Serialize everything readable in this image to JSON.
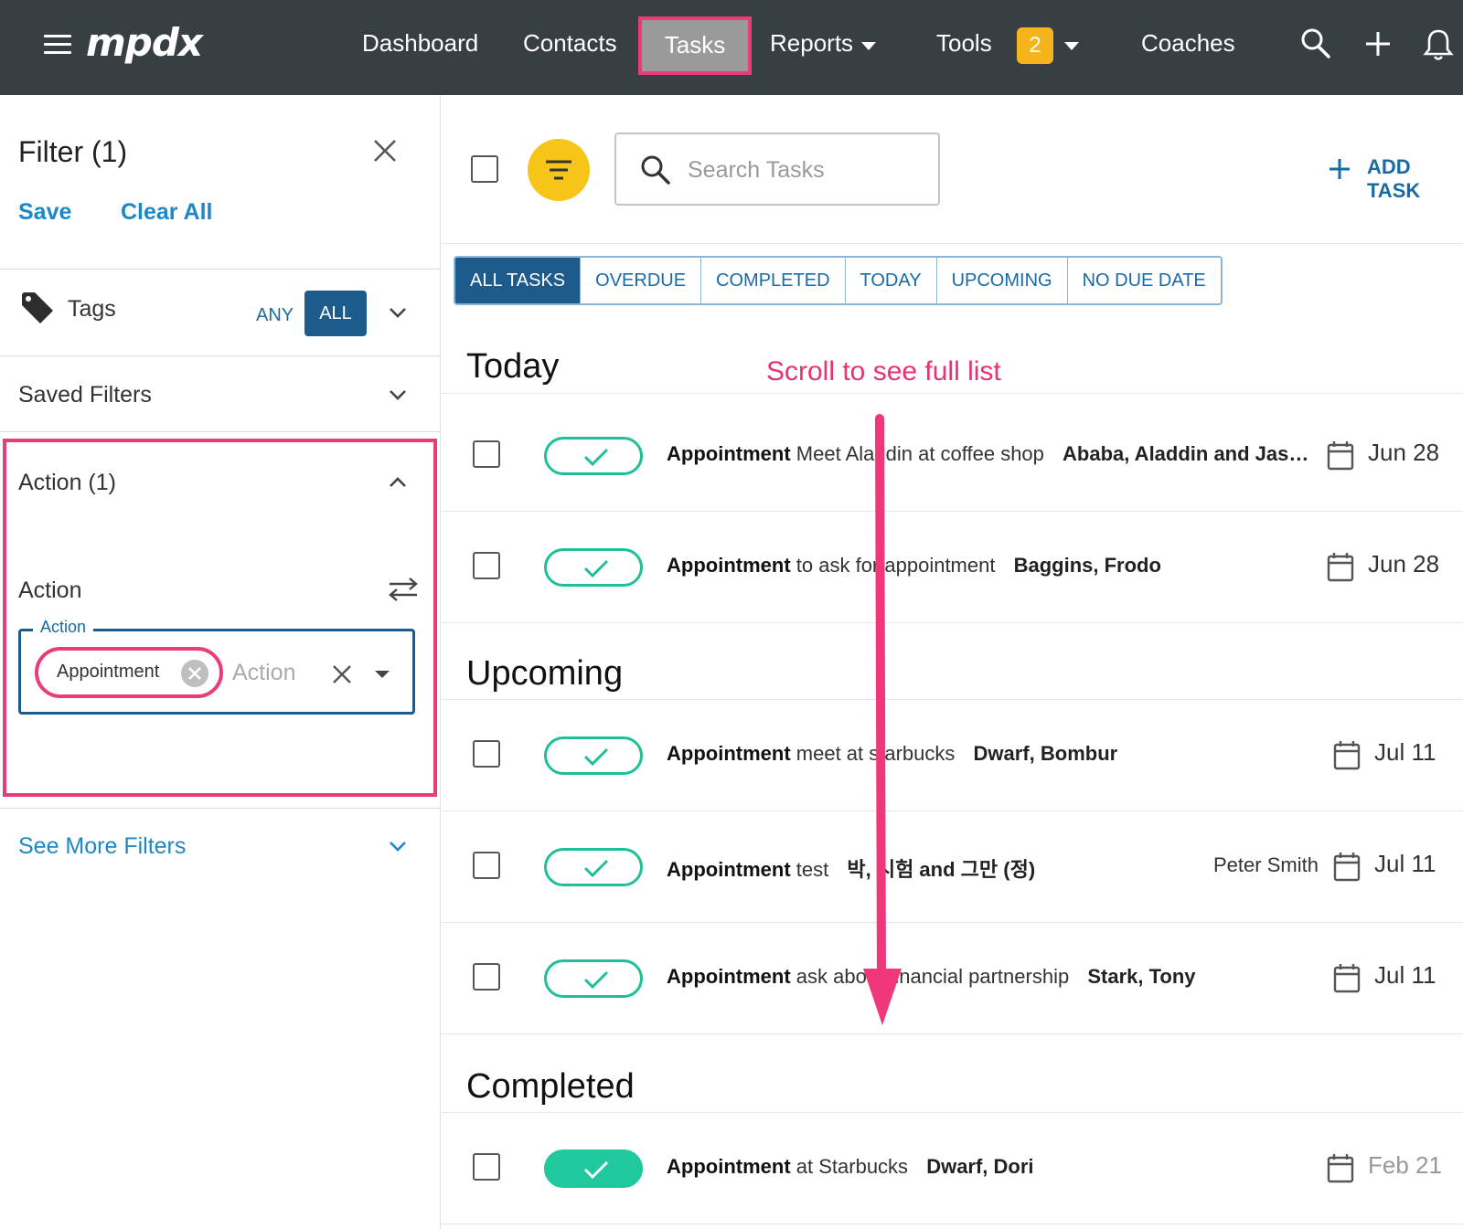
{
  "nav": {
    "logo": "mpdx",
    "items": {
      "dashboard": "Dashboard",
      "contacts": "Contacts",
      "tasks": "Tasks",
      "reports": "Reports",
      "tools": "Tools",
      "coaches": "Coaches"
    },
    "tools_badge": "2"
  },
  "sidebar": {
    "title": "Filter (1)",
    "save": "Save",
    "clear_all": "Clear All",
    "tags": {
      "label": "Tags",
      "any": "ANY",
      "all": "ALL"
    },
    "saved_filters": "Saved Filters",
    "action_section": {
      "title": "Action (1)",
      "field_label": "Action",
      "legend": "Action",
      "chip": "Appointment",
      "placeholder": "Action"
    },
    "see_more": "See More Filters"
  },
  "toolbar": {
    "search_placeholder": "Search Tasks",
    "add_task": "ADD TASK"
  },
  "tabs": [
    "ALL TASKS",
    "OVERDUE",
    "COMPLETED",
    "TODAY",
    "UPCOMING",
    "NO DUE DATE"
  ],
  "annotation": "Scroll to see full list",
  "sections": {
    "today": "Today",
    "upcoming": "Upcoming",
    "completed": "Completed"
  },
  "tasks": {
    "t1": {
      "type": "Appointment",
      "subject": "Meet Aladdin at coffee shop",
      "contact": "Ababa, Aladdin and Jas…",
      "assignee": "",
      "date": "Jun 28"
    },
    "t2": {
      "type": "Appointment",
      "subject": "to ask for appointment",
      "contact": "Baggins, Frodo",
      "assignee": "",
      "date": "Jun 28"
    },
    "u1": {
      "type": "Appointment",
      "subject": "meet at starbucks",
      "contact": "Dwarf, Bombur",
      "assignee": "",
      "date": "Jul 11"
    },
    "u2": {
      "type": "Appointment",
      "subject": "test",
      "contact": "박, 시험 and 그만 (정)",
      "assignee": "Peter Smith",
      "date": "Jul 11"
    },
    "u3": {
      "type": "Appointment",
      "subject": "ask about financial partnership",
      "contact": "Stark, Tony",
      "assignee": "",
      "date": "Jul 11"
    },
    "c1": {
      "type": "Appointment",
      "subject": "at Starbucks",
      "contact": "Dwarf, Dori",
      "assignee": "",
      "date": "Feb 21"
    }
  },
  "colors": {
    "nav_bg": "#383f43",
    "highlight": "#ec3c78",
    "accent_blue": "#1a6aa5",
    "filter_yellow": "#f7c519",
    "complete_green": "#1fc89d",
    "badge_orange": "#f5b41b"
  },
  "icons": [
    "menu-icon",
    "search-icon",
    "plus-icon",
    "bell-icon",
    "tag-icon",
    "close-icon",
    "swap-icon",
    "filter-icon",
    "calendar-icon",
    "check-icon",
    "chevron-down-icon",
    "chevron-up-icon"
  ]
}
